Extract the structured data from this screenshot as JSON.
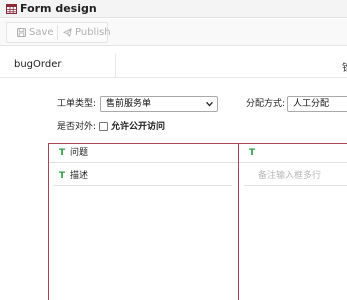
{
  "window": {
    "title": "Form design",
    "icon": "table-icon"
  },
  "toolbar": {
    "save_label": "Save",
    "publish_label": "Publish"
  },
  "form": {
    "name": "bugOrder",
    "right_cut_text": "锥"
  },
  "fields": {
    "ticket_type_label": "工单类型:",
    "ticket_type_value": "售前服务单",
    "assign_label": "分配方式:",
    "assign_value": "人工分配",
    "public_label": "是否对外:",
    "public_checkbox_label": "允许公开访问",
    "public_checked": false
  },
  "grid": {
    "cells": [
      {
        "type_icon": "T",
        "text": "问题"
      },
      {
        "type_icon": "T",
        "text": ""
      },
      {
        "type_icon": "T",
        "text": "描述"
      },
      {
        "placeholder": "备注输入框多行"
      }
    ]
  },
  "colors": {
    "grid_border": "#a94552",
    "type_icon": "#2e9e45"
  }
}
